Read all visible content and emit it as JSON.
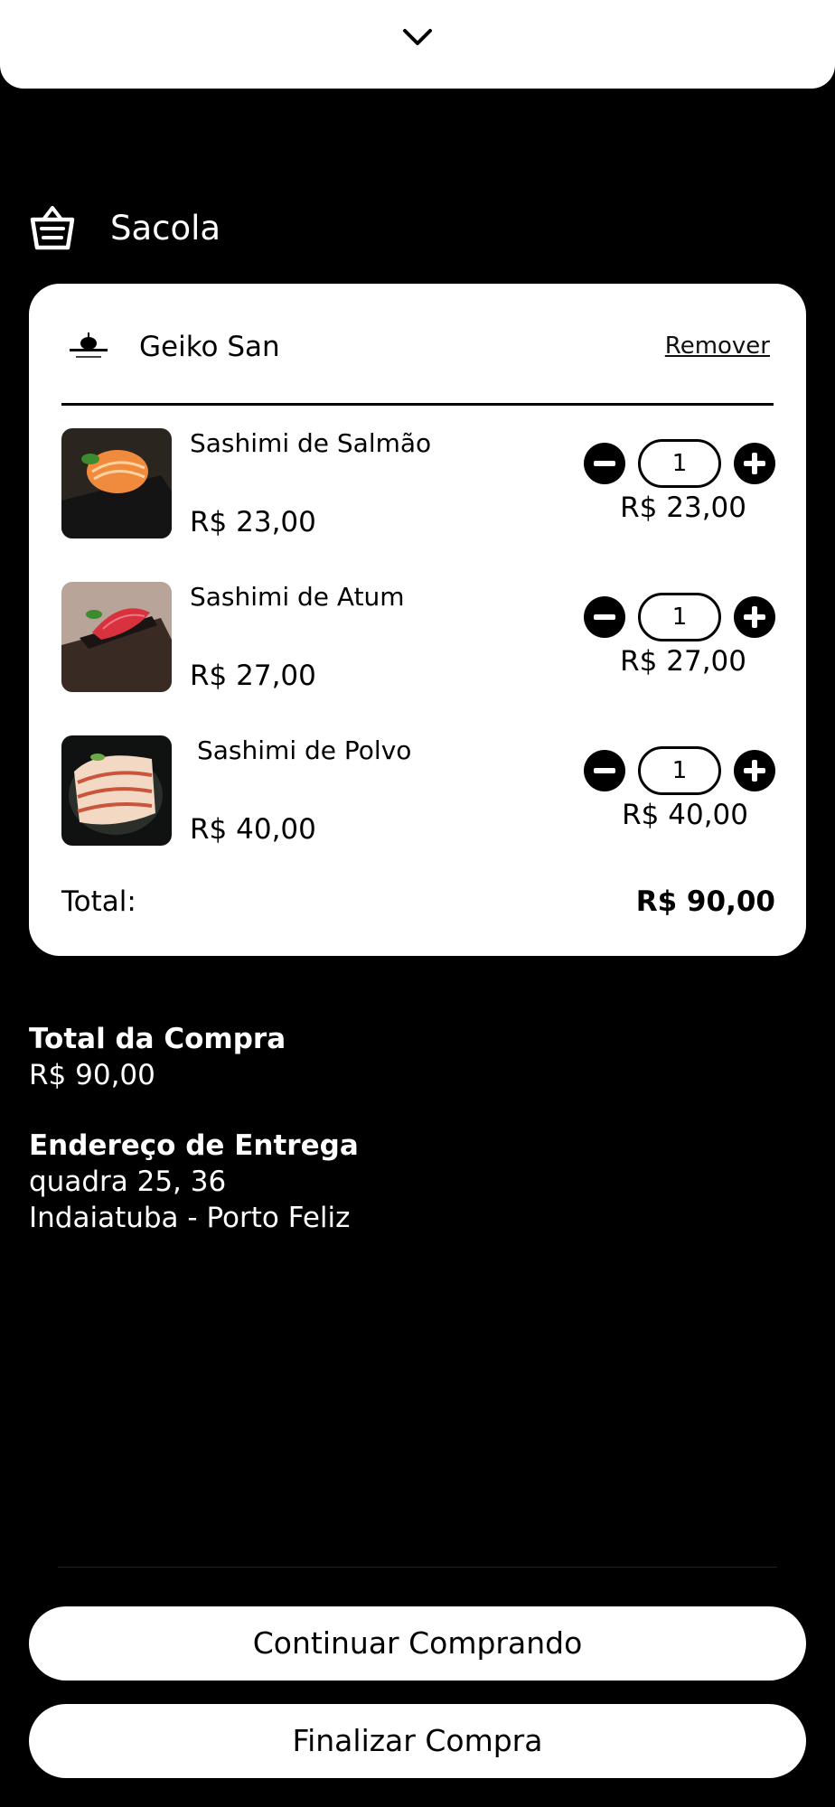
{
  "header": {
    "collapse_icon": "chevron-down-icon"
  },
  "bag": {
    "icon": "basket-icon",
    "title": "Sacola"
  },
  "cart": {
    "store_name": "Geiko San",
    "remove_label": "Remover",
    "items": [
      {
        "name": "Sashimi de Salmão",
        "price": "R$ 23,00",
        "quantity": "1",
        "subtotal": "R$ 23,00"
      },
      {
        "name": "Sashimi de Atum",
        "price": "R$ 27,00",
        "quantity": "1",
        "subtotal": "R$ 27,00"
      },
      {
        "name": "Sashimi de Polvo",
        "price": "R$ 40,00",
        "quantity": "1",
        "subtotal": "R$ 40,00"
      }
    ],
    "total_label": "Total:",
    "total_value": "R$ 90,00"
  },
  "summary": {
    "purchase_total_label": "Total da Compra",
    "purchase_total_value": "R$ 90,00",
    "address_label": "Endereço de Entrega",
    "address_line1": "quadra 25, 36",
    "address_line2": "Indaiatuba - Porto Feliz"
  },
  "actions": {
    "continue_label": "Continuar Comprando",
    "finish_label": "Finalizar Compra"
  }
}
